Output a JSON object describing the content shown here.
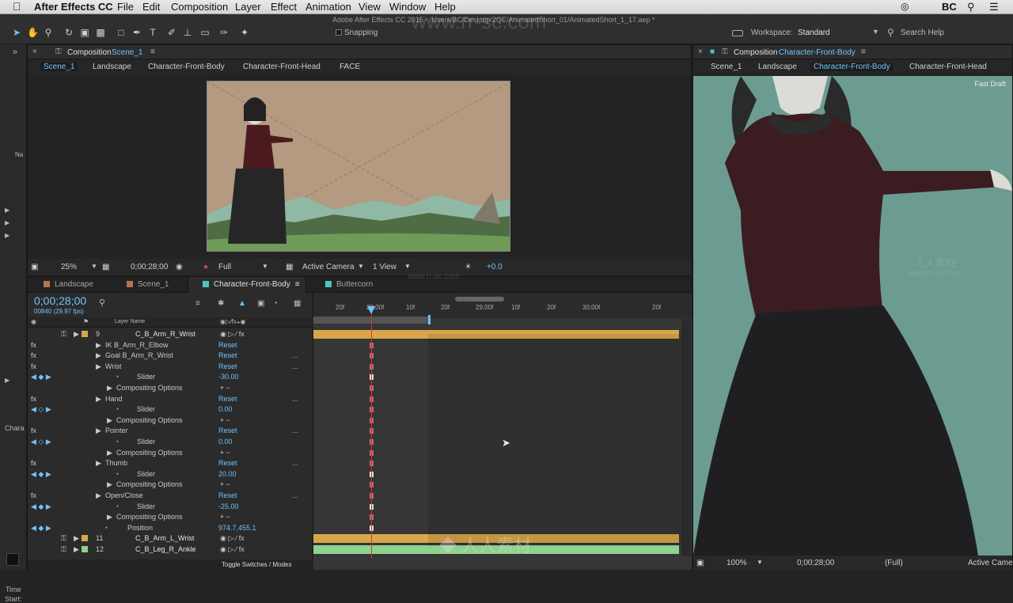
{
  "menubar": {
    "app": "After Effects CC",
    "items": [
      "File",
      "Edit",
      "Composition",
      "Layer",
      "Effect",
      "Animation",
      "View",
      "Window",
      "Help"
    ],
    "user": "BC"
  },
  "window_title": "Adobe After Effects CC 2015 - /Users/BC/Desktop/2QE/AnimatedShort_01/AnimatedShort_1_17.aep *",
  "toolbar": {
    "snapping": "Snapping",
    "workspace_label": "Workspace:",
    "workspace_value": "Standard",
    "search": "Search Help"
  },
  "comp_panel": {
    "title": "Composition",
    "name": "Scene_1",
    "crumbs": [
      "Scene_1",
      "Landscape",
      "Character-Front-Body",
      "Character-Front-Head",
      "FACE"
    ],
    "zoom": "25%",
    "timecode": "0;00;28;00",
    "resolution": "Full",
    "camera": "Active Camera",
    "views": "1 View",
    "exposure": "+0.0"
  },
  "right_panel": {
    "title": "Composition",
    "name": "Character-Front-Body",
    "crumbs": [
      "Scene_1",
      "Landscape",
      "Character-Front-Body",
      "Character-Front-Head"
    ],
    "label": "Fast Draft",
    "zoom": "100%",
    "timecode": "0;00;28;00",
    "resolution": "(Full)",
    "camera": "Active Came"
  },
  "timeline": {
    "tabs": [
      "Landscape",
      "Scene_1",
      "Character-Front-Body",
      "Buttercorn"
    ],
    "tab_colors": [
      "#b0764e",
      "#b0764e",
      "#4fc3c3",
      "#4fc3c3"
    ],
    "timecode": "0;00;28;00",
    "frames": "00840 (29.97 fps)",
    "col_layer_name": "Layer Name",
    "ruler": [
      "20f",
      "28;00f",
      "10f",
      "20f",
      "29;00f",
      "10f",
      "20f",
      "30;00f",
      "20f"
    ],
    "footer": "Toggle Switches / Modes",
    "layers": [
      {
        "kind": "layer",
        "num": "9",
        "name": "C_B_Arm_R_Wrist",
        "color": "#d9a74a"
      },
      {
        "kind": "effect",
        "name": "IK B_Arm_R_Elbow",
        "reset": "Reset"
      },
      {
        "kind": "effect",
        "name": "Goal B_Arm_R_Wrist",
        "reset": "Reset",
        "dots": "..."
      },
      {
        "kind": "effect",
        "name": "Wrist",
        "reset": "Reset",
        "dots": "..."
      },
      {
        "kind": "prop",
        "name": "Slider",
        "value": "-30.00",
        "key": true
      },
      {
        "kind": "comp",
        "name": "Compositing Options",
        "value": "+ −"
      },
      {
        "kind": "effect",
        "name": "Hand",
        "reset": "Reset",
        "dots": "..."
      },
      {
        "kind": "prop",
        "name": "Slider",
        "value": "0.00",
        "key": false
      },
      {
        "kind": "comp",
        "name": "Compositing Options",
        "value": "+ −"
      },
      {
        "kind": "effect",
        "name": "Pointer",
        "reset": "Reset",
        "dots": "..."
      },
      {
        "kind": "prop",
        "name": "Slider",
        "value": "0.00",
        "key": false
      },
      {
        "kind": "comp",
        "name": "Compositing Options",
        "value": "+ −"
      },
      {
        "kind": "effect",
        "name": "Thumb",
        "reset": "Reset",
        "dots": "..."
      },
      {
        "kind": "prop",
        "name": "Slider",
        "value": "20.00",
        "key": true
      },
      {
        "kind": "comp",
        "name": "Compositing Options",
        "value": "+ −"
      },
      {
        "kind": "effect",
        "name": "Open/Close",
        "reset": "Reset",
        "dots": "..."
      },
      {
        "kind": "prop",
        "name": "Slider",
        "value": "-25.00",
        "key": true
      },
      {
        "kind": "comp",
        "name": "Compositing Options",
        "value": "+ −"
      },
      {
        "kind": "pos",
        "name": "Position",
        "value": "974.7,455.1",
        "key": true
      },
      {
        "kind": "layer",
        "num": "11",
        "name": "C_B_Arm_L_Wrist",
        "color": "#d9a74a"
      },
      {
        "kind": "layer",
        "num": "12",
        "name": "C_B_Leg_R_Ankle",
        "color": "#8fd18f"
      }
    ]
  },
  "left_strip": {
    "label1": "Na",
    "label2": "Chara",
    "label3": "Time",
    "label4": "Start:"
  },
  "watermarks": {
    "site": "www.rr-sc.com",
    "cn": "人人素材",
    "brand": "人人素材"
  }
}
